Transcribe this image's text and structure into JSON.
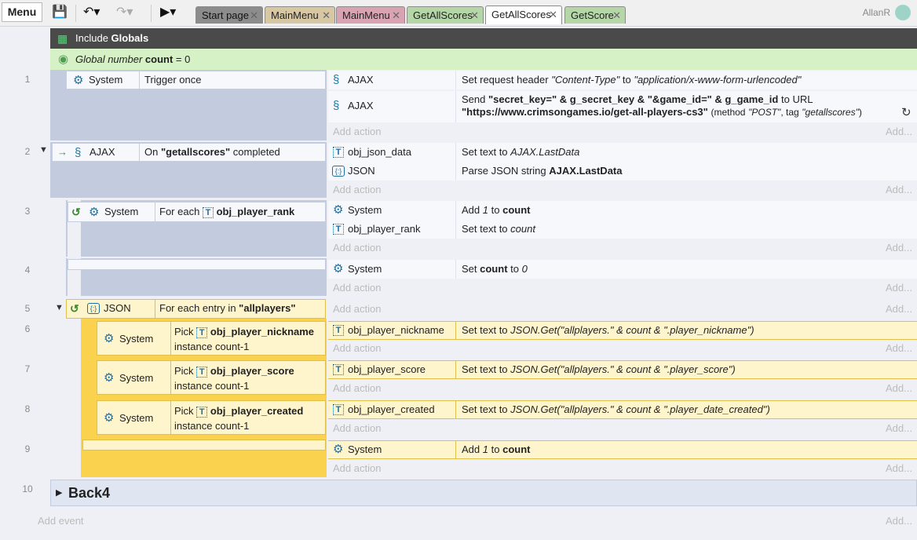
{
  "toolbar": {
    "menu_label": "Menu",
    "save_icon": "save-icon",
    "undo_icon": "undo-icon",
    "redo_icon": "redo-icon",
    "play_icon": "play-icon"
  },
  "tabs": [
    {
      "label": "Start page",
      "color": "#8c8c8c"
    },
    {
      "label": "MainMenu",
      "color": "#d7c7a2"
    },
    {
      "label": "MainMenu",
      "color": "#d8a4b3"
    },
    {
      "label": "GetAllScores",
      "color": "#b5d7a7"
    },
    {
      "label": "GetAllScores",
      "color": "#ffffff"
    },
    {
      "label": "GetScore",
      "color": "#b5d7a7"
    }
  ],
  "user": {
    "name": "AllanR"
  },
  "include": {
    "prefix": "Include",
    "name": "Globals"
  },
  "global_var": {
    "prefix": "Global number",
    "name": "count",
    "suffix": "= 0"
  },
  "events": {
    "e1": {
      "num": "1",
      "cond_obj": "System",
      "cond_text": "Trigger once",
      "a1_obj": "AJAX",
      "a1_text_pre": "Set request header",
      "a1_h1": "\"Content-Type\"",
      "a1_mid": "to",
      "a1_h2": "\"application/x-www-form-urlencoded\"",
      "a2_obj": "AJAX",
      "a2_line1_pre": "Send",
      "a2_b1": "\"secret_key=\" & g_secret_key & \"&game_id=\" & g_game_id",
      "a2_line1_post": "to URL",
      "a2_b2": "\"https://www.crimsongames.io/get-all-players-cs3\"",
      "a2_line2_post": "(method",
      "a2_m": "\"POST\"",
      "a2_tag_pre": ", tag",
      "a2_tag": "\"getallscores\"",
      "a2_close": ")"
    },
    "e2": {
      "num": "2",
      "cond_obj": "AJAX",
      "cond_pre": "On",
      "cond_b": "\"getallscores\"",
      "cond_post": "completed",
      "a1_obj": "obj_json_data",
      "a1_pre": "Set text to",
      "a1_i": "AJAX.LastData",
      "a2_obj": "JSON",
      "a2_pre": "Parse JSON string",
      "a2_b": "AJAX.LastData"
    },
    "e3": {
      "num": "3",
      "cond_obj": "System",
      "cond_pre": "For each",
      "cond_b": "obj_player_rank",
      "a1_obj": "System",
      "a1_pre": "Add",
      "a1_i": "1",
      "a1_mid": "to",
      "a1_b": "count",
      "a2_obj": "obj_player_rank",
      "a2_pre": "Set text to",
      "a2_i": "count"
    },
    "e4": {
      "num": "4",
      "a1_obj": "System",
      "a1_pre": "Set",
      "a1_b": "count",
      "a1_mid": "to",
      "a1_i": "0"
    },
    "e5": {
      "num": "5",
      "cond_obj": "JSON",
      "cond_pre": "For each entry in",
      "cond_b": "\"allplayers\""
    },
    "e6": {
      "num": "6",
      "cond_obj": "System",
      "cond_pre": "Pick",
      "cond_b": "obj_player_nickname",
      "cond_line2": "instance count-1",
      "a1_obj": "obj_player_nickname",
      "a1_pre": "Set text to",
      "a1_i": "JSON.Get(\"allplayers.\" & count & \".player_nickname\")"
    },
    "e7": {
      "num": "7",
      "cond_obj": "System",
      "cond_pre": "Pick",
      "cond_b": "obj_player_score",
      "cond_line2": "instance count-1",
      "a1_obj": "obj_player_score",
      "a1_pre": "Set text to",
      "a1_i": "JSON.Get(\"allplayers.\" & count & \".player_score\")"
    },
    "e8": {
      "num": "8",
      "cond_obj": "System",
      "cond_pre": "Pick",
      "cond_b": "obj_player_created",
      "cond_line2": "instance count-1",
      "a1_obj": "obj_player_created",
      "a1_pre": "Set text to",
      "a1_i": "JSON.Get(\"allplayers.\" & count & \".player_date_created\")"
    },
    "e9": {
      "num": "9",
      "a1_obj": "System",
      "a1_pre": "Add",
      "a1_i": "1",
      "a1_mid": "to",
      "a1_b": "count"
    },
    "e10": {
      "num": "10",
      "group_name": "Back4"
    }
  },
  "labels": {
    "add_action": "Add action",
    "add": "Add...",
    "add_event": "Add event"
  }
}
